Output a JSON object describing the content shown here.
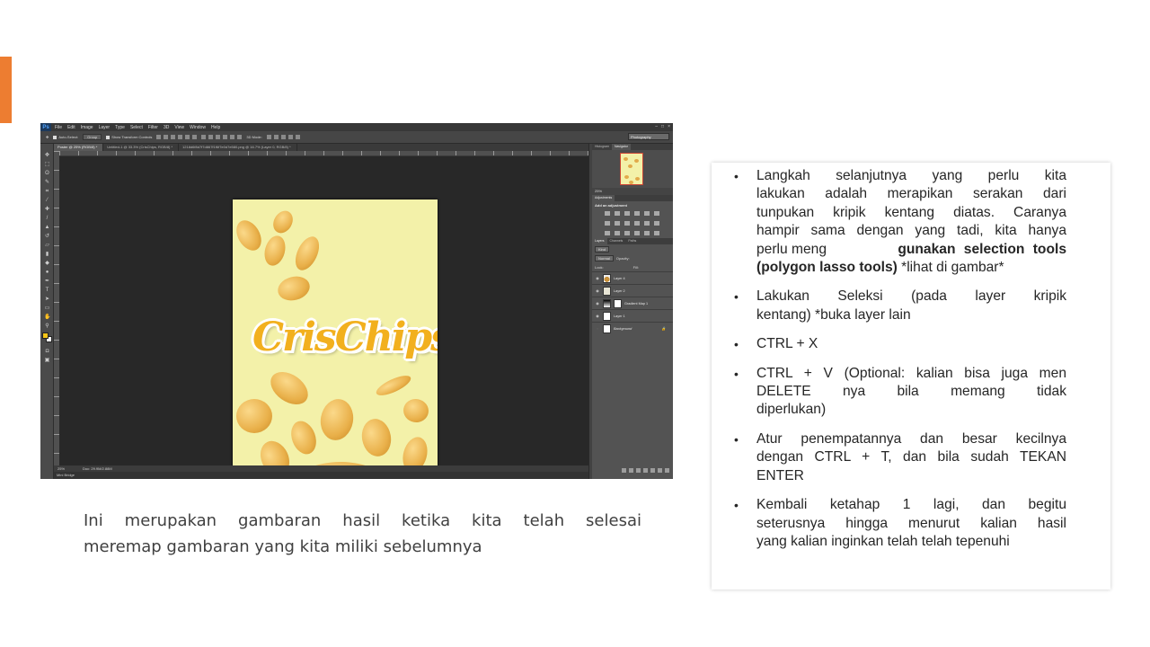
{
  "photoshop": {
    "logo": "Ps",
    "menus": [
      "File",
      "Edit",
      "Image",
      "Layer",
      "Type",
      "Select",
      "Filter",
      "3D",
      "View",
      "Window",
      "Help"
    ],
    "window_buttons": [
      "–",
      "□",
      "×"
    ],
    "options": {
      "auto_select": "Auto-Select:",
      "auto_select_value": "Group",
      "show_transform": "Show Transform Controls",
      "mode_3d": "3D Mode:"
    },
    "workspace": "Photography",
    "tabs": [
      "Poster @ 25% (RGB/8) *",
      "Untitled-1 @ 33.3% (CrisChips, RGB/8) *",
      "1218d6f8d7f7d867f1f6f7e0d7e580.png @ 16.7% (Layer 0, RGB/8) *"
    ],
    "doc_brand": "CrisChips",
    "status": {
      "zoom": "25%",
      "doc_size": "Doc: 29.9M/2.88M"
    },
    "mini_bridge": "Mini Bridge",
    "panels": {
      "top_tabs": [
        "Histogram",
        "Navigator"
      ],
      "nav_zoom": "25%",
      "adjustments_tab": "Adjustments",
      "adjustments_title": "Add an adjustment",
      "layer_tabs": [
        "Layers",
        "Channels",
        "Paths"
      ],
      "kind_filter": "Kind",
      "blend_mode": "Normal",
      "opacity_label": "Opacity:",
      "fill_label": "Fill:",
      "lock_label": "Lock:",
      "layers": [
        "Layer 4",
        "Layer 2",
        "Gradient Map 1",
        "Layer 1",
        "Background"
      ]
    }
  },
  "caption": {
    "line1": "Ini merupakan gambaran hasil ketika kita telah selesai",
    "line2": "meremap gambaran yang kita miliki sebelumnya"
  },
  "notes": {
    "b1": {
      "l1": "Langkah selanjutnya yang perlu kita",
      "l2": "lakukan adalah merapikan serakan dari",
      "l3": "tunpukan kripik kentang diatas. Caranya",
      "l4": "hampir sama dengan yang tadi, kita hanya",
      "l5a": "perlu meng",
      "l5b": "gunakan selection tools",
      "l6a": "(polygon lasso tools)",
      "l6b": " *lihat di gambar*"
    },
    "b2": {
      "l1": "Lakukan Seleksi (pada layer kripik",
      "l2": "kentang) *buka layer lain"
    },
    "b3": "CTRL + X",
    "b4": {
      "l1": "CTRL + V (Optional: kalian bisa juga men",
      "l2": "DELETE nya bila memang tidak",
      "l3": "diperlukan)"
    },
    "b5": {
      "l1": "Atur penempatannya dan besar kecilnya",
      "l2": "dengan CTRL + T, dan bila sudah TEKAN",
      "l3": "ENTER"
    },
    "b6": {
      "l1": "Kembali ketahap 1 lagi, dan begitu",
      "l2": "seterusnya hingga menurut kalian hasil",
      "l3": "yang kalian inginkan telah telah tepenuhi"
    },
    "bullet": "•"
  }
}
